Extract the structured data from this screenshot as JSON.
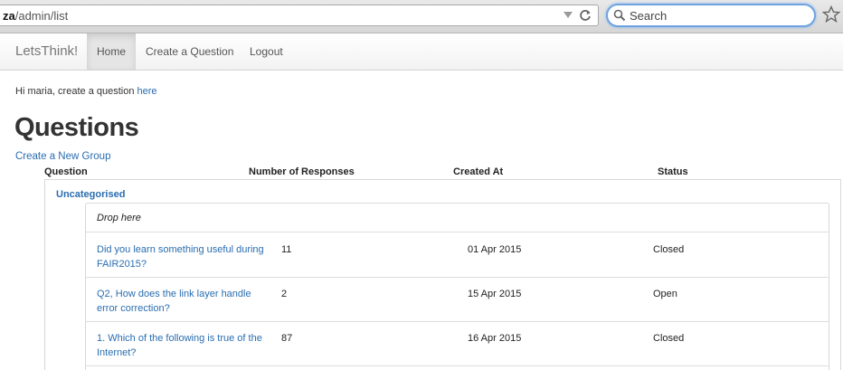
{
  "browser": {
    "url_host": "za",
    "url_path": "/admin/list",
    "search_placeholder": "Search",
    "icons": [
      "reload-icon",
      "search-icon",
      "star-icon",
      "dropdown-arrow-icon"
    ]
  },
  "navbar": {
    "brand": "LetsThink!",
    "items": [
      {
        "label": "Home",
        "active": true
      },
      {
        "label": "Create a Question",
        "active": false
      },
      {
        "label": "Logout",
        "active": false
      }
    ]
  },
  "greeting": {
    "prefix": "Hi maria, create a question ",
    "link": "here"
  },
  "page": {
    "title": "Questions",
    "new_group_link": "Create a New Group"
  },
  "columns": {
    "question": "Question",
    "responses": "Number of Responses",
    "created": "Created At",
    "status": "Status"
  },
  "group": {
    "name": "Uncategorised",
    "drop_hint": "Drop here",
    "questions": [
      {
        "text": "Did you learn something useful during FAIR2015?",
        "responses": "11",
        "created": "01 Apr 2015",
        "status": "Closed"
      },
      {
        "text": "Q2, How does the link layer handle error correction?",
        "responses": "2",
        "created": "15 Apr 2015",
        "status": "Open"
      },
      {
        "text": "1. Which of the following is true of the Internet?",
        "responses": "87",
        "created": "16 Apr 2015",
        "status": "Closed"
      }
    ]
  },
  "colors": {
    "link": "#2a6db0",
    "nav_active_bg": "#e5e5e5",
    "search_focus": "#6fa3e0"
  }
}
